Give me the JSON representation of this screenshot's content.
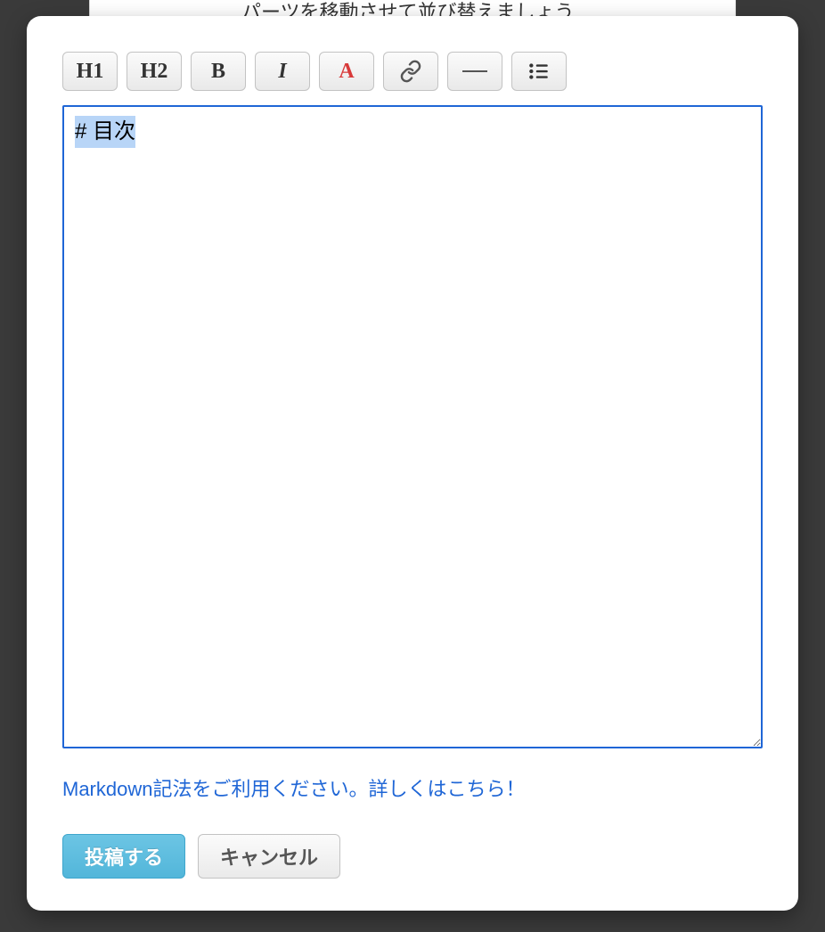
{
  "backdrop": {
    "hint_text": "パーツを移動させて並び替えましょう"
  },
  "toolbar": {
    "h1_label": "H1",
    "h2_label": "H2",
    "bold_label": "B",
    "italic_label": "I",
    "color_label": "A"
  },
  "editor": {
    "content": "# 目次"
  },
  "help": {
    "link_text": "Markdown記法をご利用ください。詳しくはこちら！"
  },
  "footer": {
    "submit_label": "投稿する",
    "cancel_label": "キャンセル"
  }
}
